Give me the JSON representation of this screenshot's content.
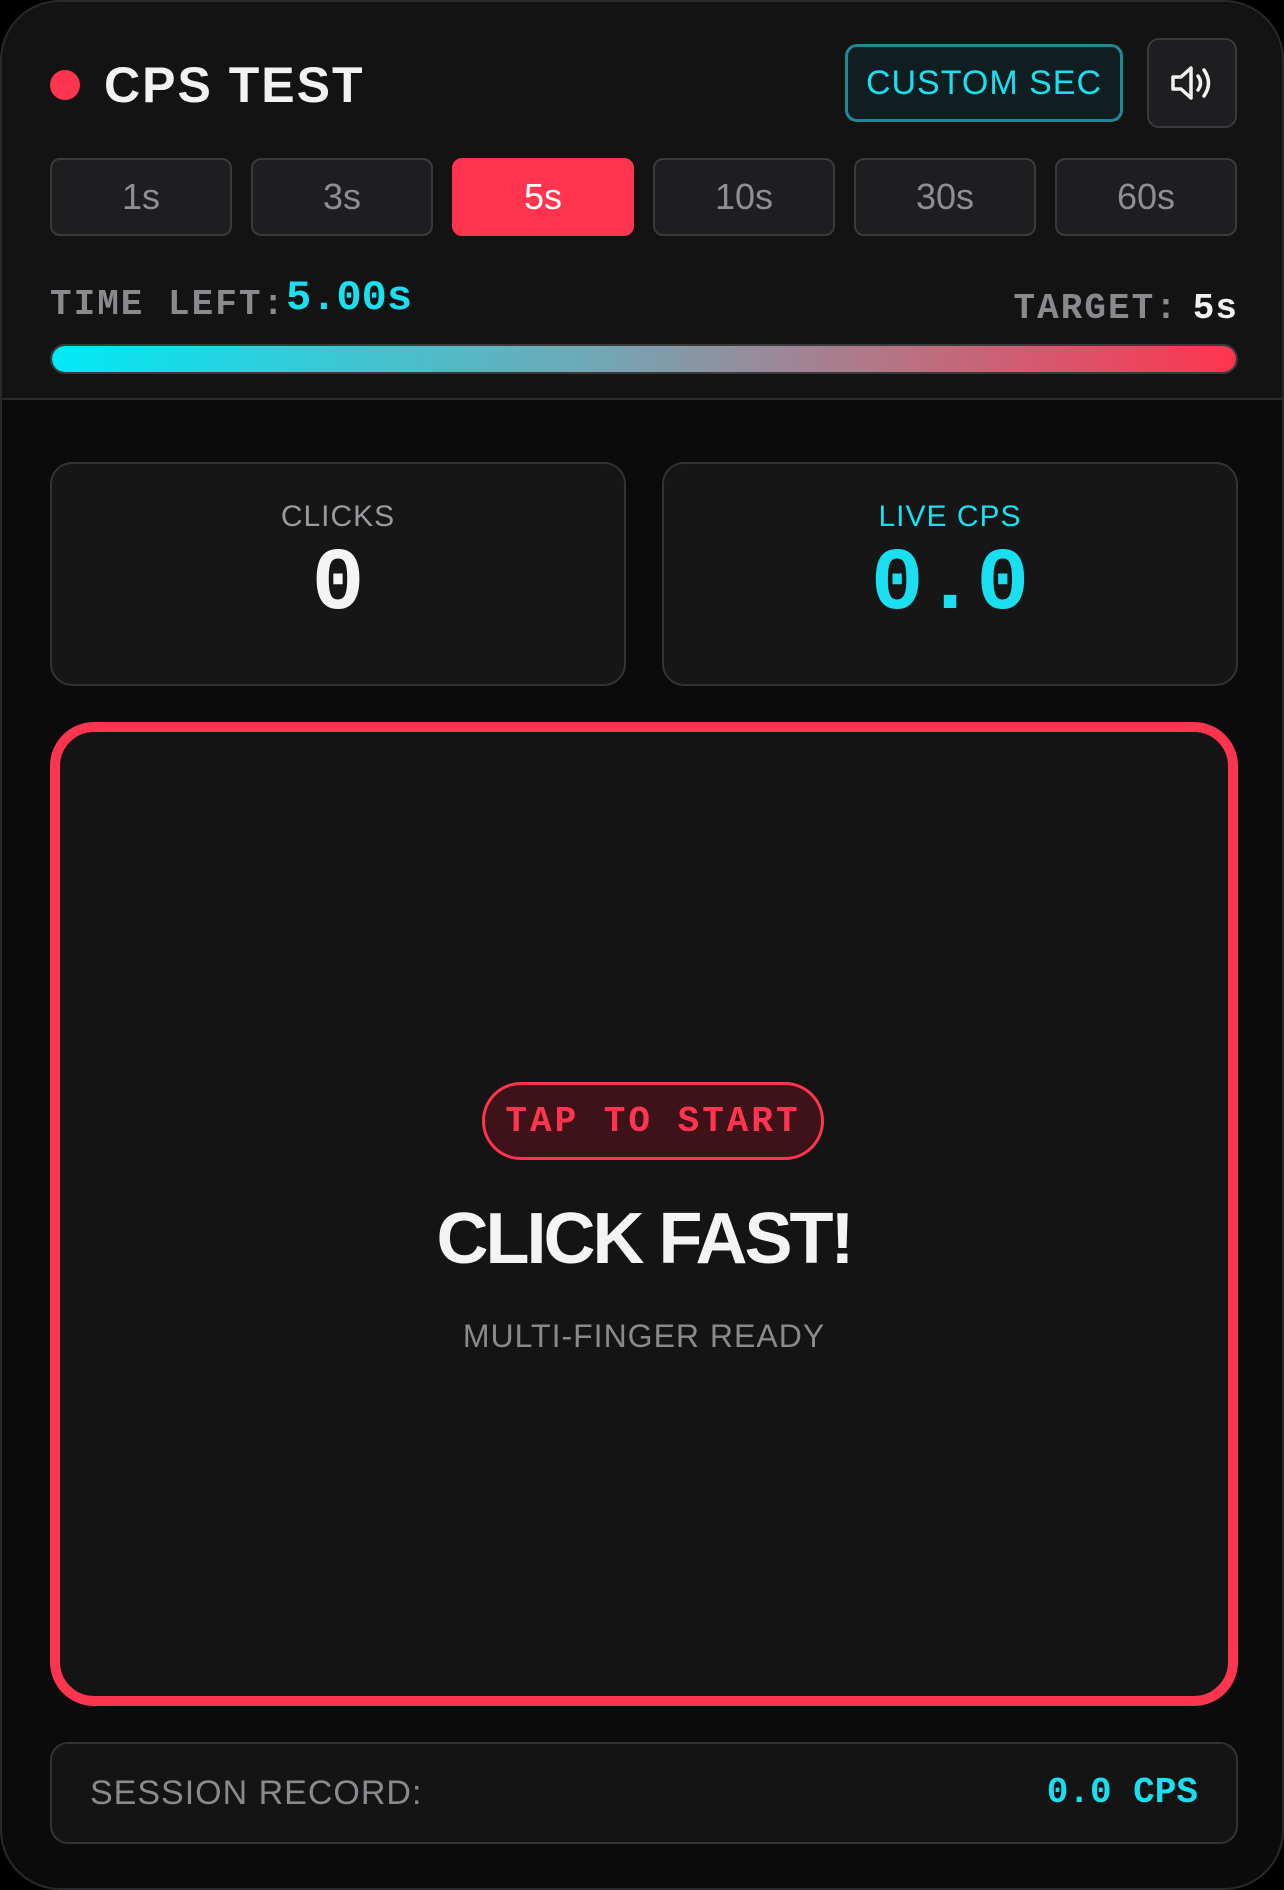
{
  "header": {
    "title": "CPS TEST",
    "custom_label": "CUSTOM SEC",
    "sound_icon": "speaker-icon"
  },
  "durations": [
    {
      "label": "1s",
      "active": false
    },
    {
      "label": "3s",
      "active": false
    },
    {
      "label": "5s",
      "active": true
    },
    {
      "label": "10s",
      "active": false
    },
    {
      "label": "30s",
      "active": false
    },
    {
      "label": "60s",
      "active": false
    }
  ],
  "timer": {
    "label": "TIME LEFT:",
    "value": "5.00s",
    "target_label": "TARGET:",
    "target_value": "5s",
    "progress_fraction": 1.0
  },
  "stats": {
    "clicks_label": "CLICKS",
    "clicks_value": "0",
    "cps_label": "LIVE CPS",
    "cps_value": "0.0"
  },
  "click_area": {
    "pill": "TAP TO START",
    "headline": "CLICK FAST!",
    "subtext": "MULTI-FINGER READY"
  },
  "record": {
    "label": "SESSION RECORD:",
    "value": "0.0 CPS"
  },
  "colors": {
    "accent_red": "#ff344f",
    "accent_cyan": "#19dff0",
    "background": "#0b0b0c"
  }
}
